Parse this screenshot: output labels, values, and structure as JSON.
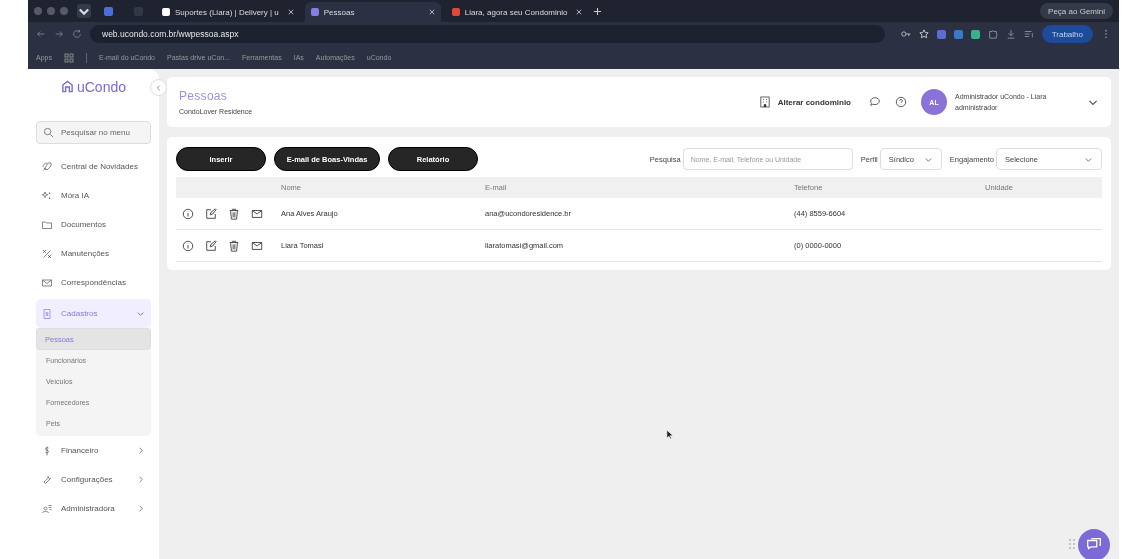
{
  "browser": {
    "tabs": [
      {
        "title": "Suportes (Liara) | Delivery | u",
        "selected": false
      },
      {
        "title": "Pessoas",
        "selected": true
      },
      {
        "title": "Liara, agora seu Condominio",
        "selected": false
      }
    ],
    "gemini_button": "Peça ao Gemini",
    "address": "web.ucondo.com.br/wwpessoa.aspx",
    "profile_button": "Trabalho",
    "bookmarks": [
      "E-mail do uCondo",
      "Pastas drive uCon...",
      "Ferramentas",
      "IAs",
      "Automações",
      "uCondo"
    ],
    "apps_label": "Apps"
  },
  "sidebar": {
    "logo": "uCondo",
    "search_placeholder": "Pesquisar no menu",
    "items": [
      {
        "label": "Central de Novidades"
      },
      {
        "label": "Móra IA"
      },
      {
        "label": "Documentos"
      },
      {
        "label": "Manutenções"
      },
      {
        "label": "Correspondências"
      },
      {
        "label": "Cadastros",
        "expanded": true,
        "children": [
          {
            "label": "Pessoas",
            "selected": true
          },
          {
            "label": "Funcionários",
            "selected": false
          },
          {
            "label": "Veículos",
            "selected": false
          },
          {
            "label": "Fornecedores",
            "selected": false
          },
          {
            "label": "Pets",
            "selected": false
          }
        ]
      },
      {
        "label": "Financeiro",
        "expanded": false
      },
      {
        "label": "Configurações",
        "expanded": false
      },
      {
        "label": "Administradora",
        "expanded": false
      }
    ]
  },
  "header": {
    "title": "Pessoas",
    "subtitle": "CondoLover Residence",
    "change_condo": "Alterar condominio",
    "avatar": "AL",
    "user_name": "Administrador uCondo - Liara",
    "user_role": "administrador"
  },
  "toolbar": {
    "buttons": [
      "Inserir",
      "E-mail de Boas-Vindas",
      "Relatório"
    ],
    "search_label": "Pesquisa",
    "search_placeholder": "Nome, E-mail, Telefone ou Unidade",
    "profile_label": "Perfil",
    "profile_value": "Síndico",
    "engagement_label": "Engajamento",
    "engagement_value": "Selecione"
  },
  "table": {
    "columns": [
      "Nome",
      "E-mail",
      "Telefone",
      "Unidade"
    ],
    "rows": [
      [
        "Ana Alves Araujo",
        "ana@ucondoresidence.br",
        "(44) 8559-6604"
      ],
      [
        "Liara Tomasi",
        "liaratomasi@gmail.com",
        "(0) 0000-0000"
      ]
    ]
  }
}
